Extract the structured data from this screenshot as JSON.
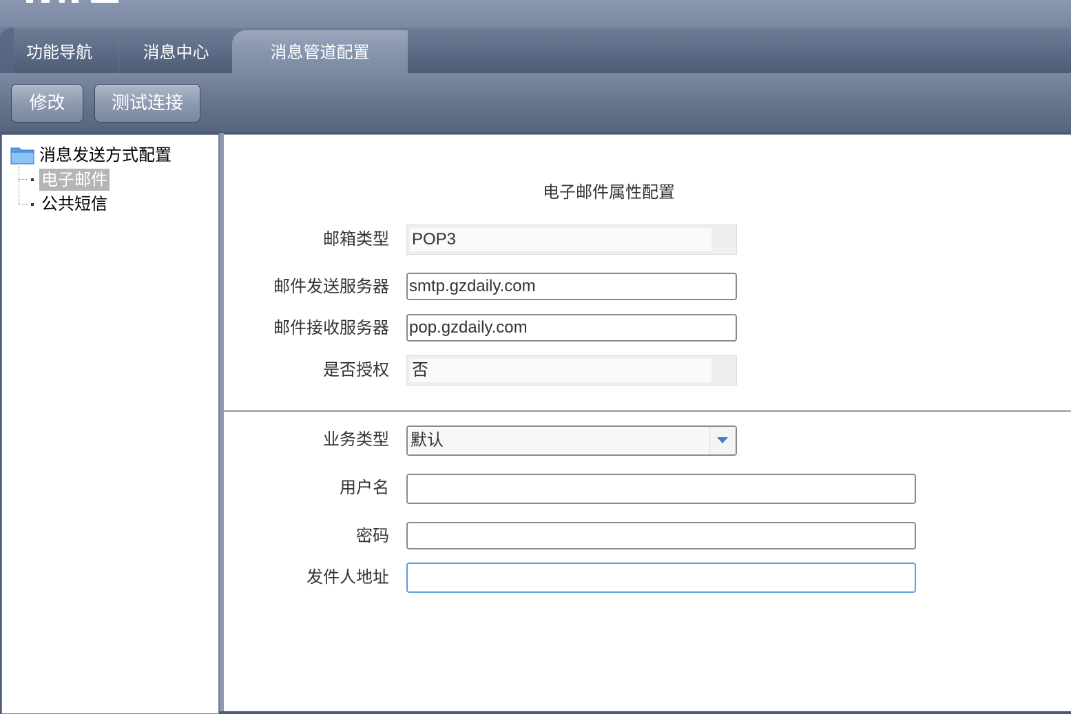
{
  "tabs": [
    {
      "label": "功能导航"
    },
    {
      "label": "消息中心"
    },
    {
      "label": "消息管道配置",
      "active": true
    }
  ],
  "toolbar": {
    "edit_label": "修改",
    "test_label": "测试连接"
  },
  "tree": {
    "root_label": "消息发送方式配置",
    "root_icon": "folder-icon",
    "items": [
      {
        "label": "电子邮件",
        "selected": true
      },
      {
        "label": "公共短信"
      }
    ]
  },
  "form": {
    "title": "电子邮件属性配置",
    "mailbox_type": {
      "label": "邮箱类型",
      "value": "POP3"
    },
    "smtp_server": {
      "label": "邮件发送服务器",
      "value": "smtp.gzdaily.com"
    },
    "pop_server": {
      "label": "邮件接收服务器",
      "value": "pop.gzdaily.com"
    },
    "auth": {
      "label": "是否授权",
      "value": "否"
    },
    "business_type": {
      "label": "业务类型",
      "value": "默认"
    },
    "username": {
      "label": "用户名",
      "value": ""
    },
    "password": {
      "label": "密码",
      "value": ""
    },
    "sender_address": {
      "label": "发件人地址",
      "value": ""
    }
  },
  "colors": {
    "header": "#5c6a85",
    "active_tab": "#8795ad",
    "selected_item": "#b5b5b5",
    "focus_border": "#5b9ee3"
  }
}
